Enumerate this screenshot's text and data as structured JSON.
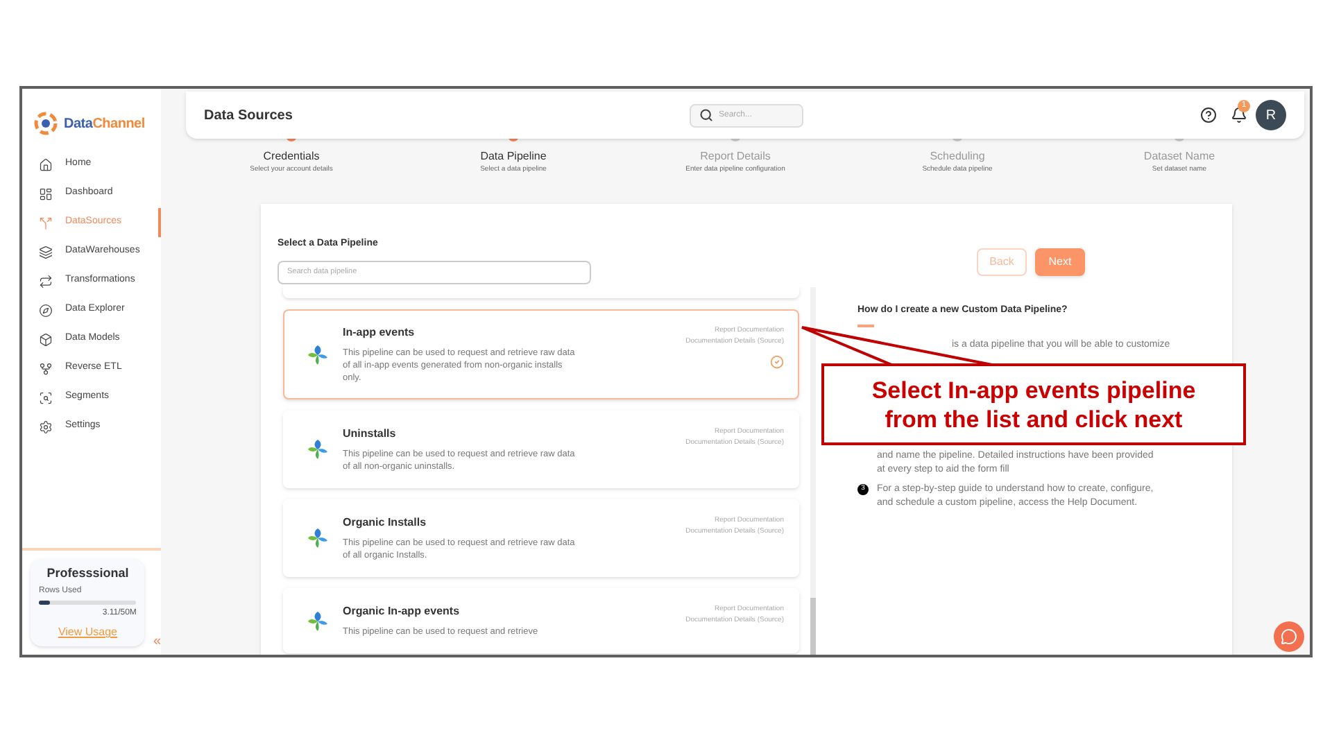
{
  "sidebar": {
    "logo": {
      "part_1": "Data",
      "part_2": "Channel"
    },
    "items": [
      {
        "label": "Home",
        "selected": false
      },
      {
        "label": "Dashboard",
        "selected": false
      },
      {
        "label": "DataSources",
        "selected": true
      },
      {
        "label": "DataWarehouses",
        "selected": false
      },
      {
        "label": "Transformations",
        "selected": false
      },
      {
        "label": "Data Explorer",
        "selected": false
      },
      {
        "label": "Data Models",
        "selected": false
      },
      {
        "label": "Reverse ETL",
        "selected": false
      },
      {
        "label": "Segments",
        "selected": false
      },
      {
        "label": "Settings",
        "selected": false
      }
    ],
    "plan": {
      "title": "Professsional",
      "rows_label": "Rows Used",
      "level": 0.12,
      "reading": "3.11/50M",
      "link": "View Usage"
    },
    "collapse": "«"
  },
  "header": {
    "title": "Data Sources",
    "search_placeholder": "Search...",
    "notification_count": "1",
    "avatar": "R"
  },
  "steps": [
    {
      "label": "Credentials",
      "subtitle": "Select your account details",
      "done": true
    },
    {
      "label": "Data Pipeline",
      "subtitle": "Select a data pipeline",
      "done": true
    },
    {
      "label": "Report Details",
      "subtitle": "Enter data pipeline configuration",
      "done": false
    },
    {
      "label": "Scheduling",
      "subtitle": "Schedule data pipeline",
      "done": false
    },
    {
      "label": "Dataset Name",
      "subtitle": "Set dataset name",
      "done": false
    }
  ],
  "pipeline_panel": {
    "title": "Select a Data Pipeline",
    "search_placeholder": "Search data pipeline",
    "pipelines": [
      {
        "name": "In-app events",
        "description": "This pipeline can be used to request and retrieve raw data of all in-app events generated from non-organic installs only.",
        "links": [
          "Report Documentation",
          "Documentation Details (Source)"
        ],
        "selected": true
      },
      {
        "name": "Uninstalls",
        "description": "This pipeline can be used to request and retrieve raw data of all non-organic uninstalls.",
        "links": [
          "Report Documentation",
          "Documentation Details (Source)"
        ],
        "selected": false
      },
      {
        "name": "Organic Installs",
        "description": "This pipeline can be used to request and retrieve raw data of all organic Installs.",
        "links": [
          "Report Documentation",
          "Documentation Details (Source)"
        ],
        "selected": false
      },
      {
        "name": "Organic In-app events",
        "description": "This pipeline can be used to request and retrieve",
        "links": [
          "Report Documentation",
          "Documentation Details (Source)"
        ],
        "selected": false
      }
    ]
  },
  "buttons": {
    "back": "Back",
    "next": "Next"
  },
  "help": {
    "title": "How do I create a new Custom Data Pipeline?",
    "items": [
      {
        "text": "is a data pipeline that you will be able to customize"
      },
      {
        "text": "and name the pipeline. Detailed instructions have been provided at every step to aid the form fill"
      },
      {
        "number": "3",
        "text": "For a step-by-step guide to understand how to create, configure, and schedule a custom pipeline, access the Help Document."
      }
    ]
  },
  "callout": {
    "text": "Select In-app events pipeline from the list and click next"
  }
}
